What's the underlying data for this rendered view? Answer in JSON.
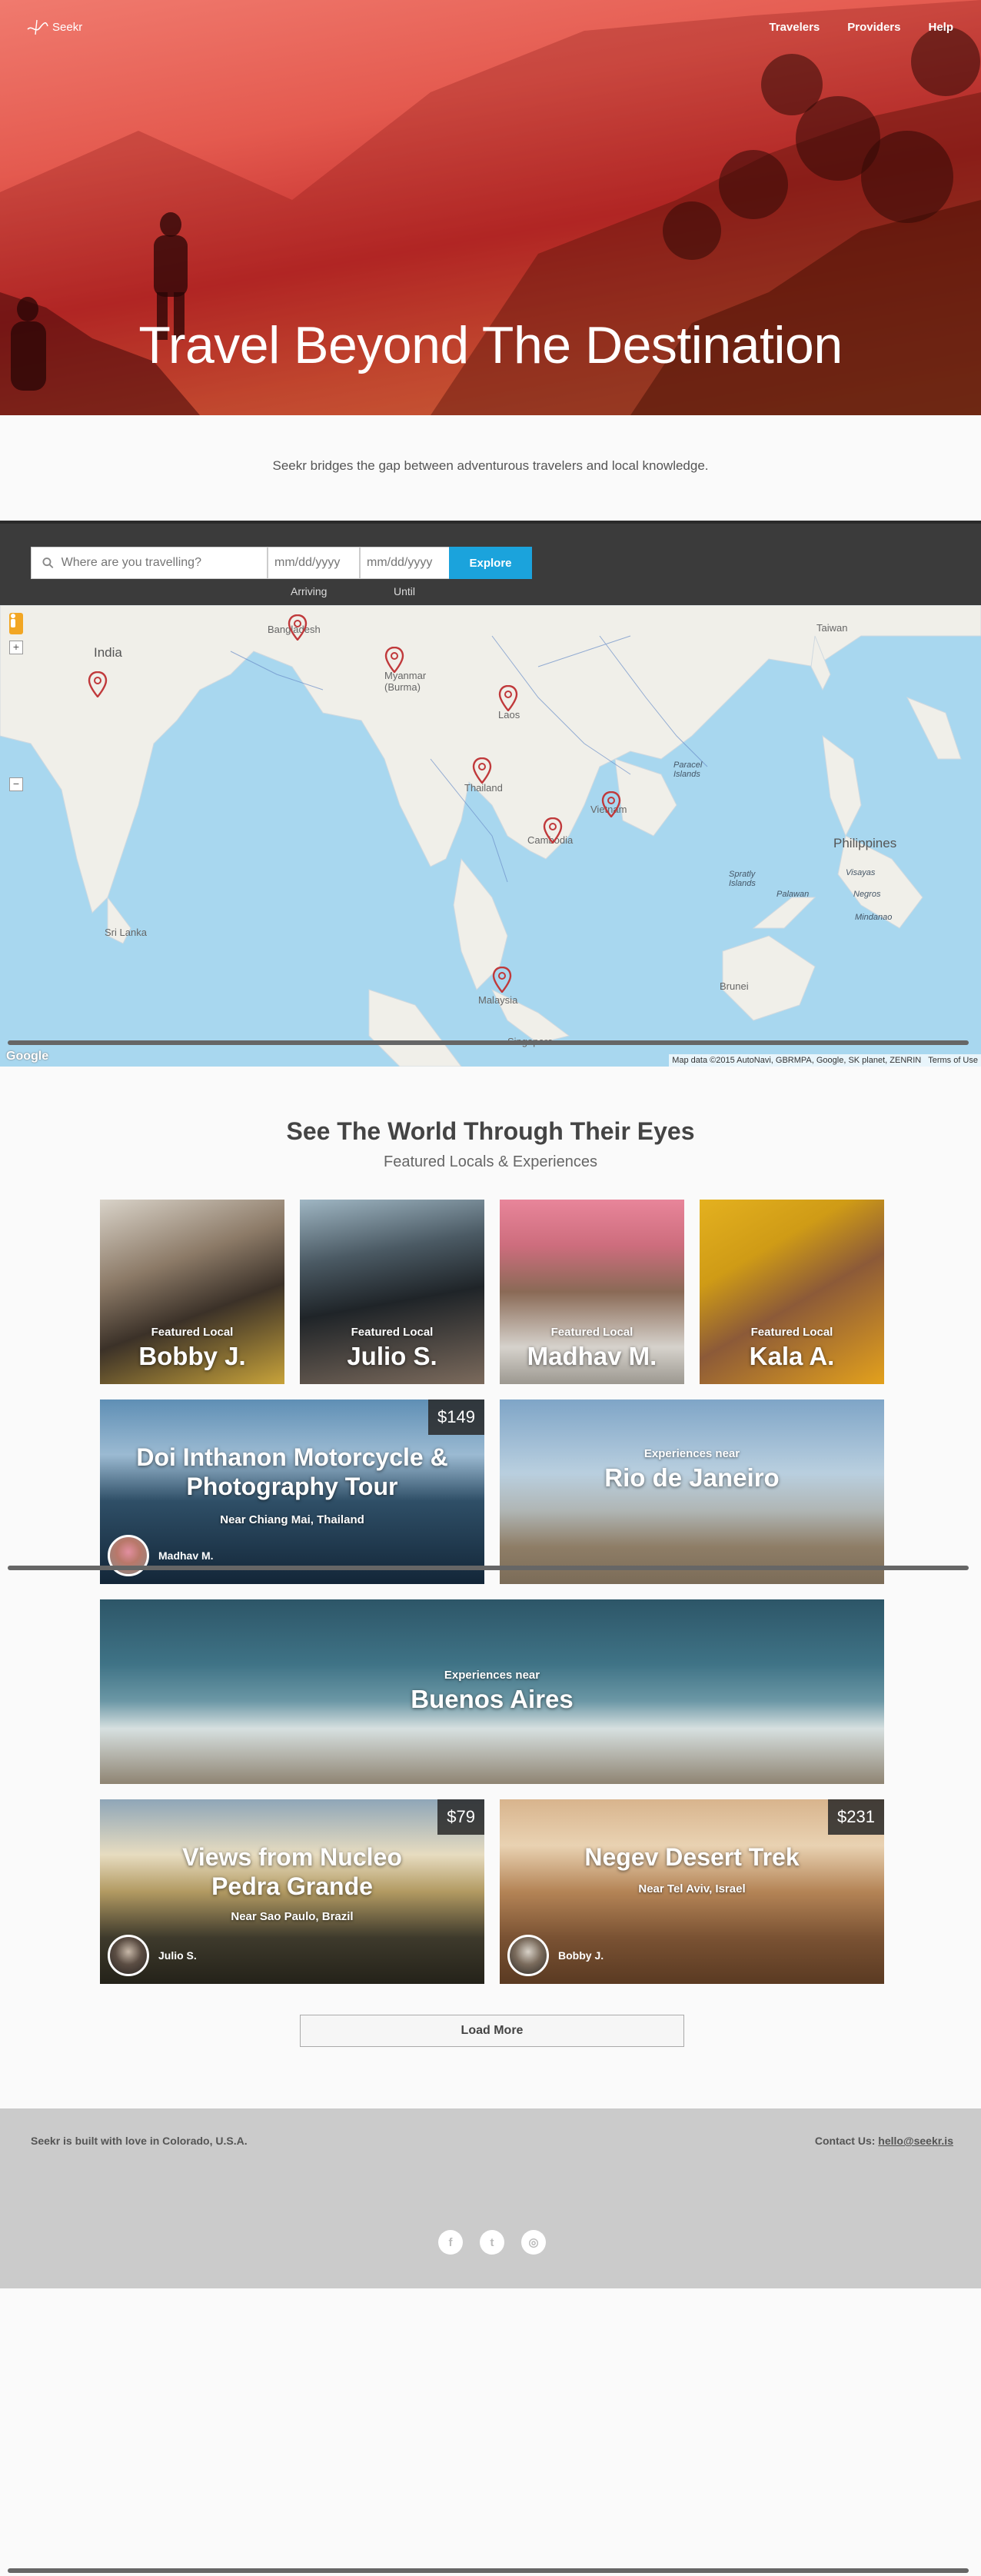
{
  "header": {
    "logo_text": "Seekr",
    "nav": [
      "Travelers",
      "Providers",
      "Help"
    ]
  },
  "hero": {
    "title": "Travel Beyond The Destination"
  },
  "tagline": "Seekr bridges the gap between adventurous travelers and local knowledge.",
  "search": {
    "place_placeholder": "Where are you travelling?",
    "date_placeholder": "mm/dd/yyyy",
    "button": "Explore",
    "arriving_label": "Arriving",
    "until_label": "Until"
  },
  "map": {
    "labels": [
      "India",
      "Bangladesh",
      "Myanmar (Burma)",
      "Laos",
      "Thailand",
      "Vietnam",
      "Cambodia",
      "Taiwan",
      "Philippines",
      "Sri Lanka",
      "Malaysia",
      "Singapore",
      "Brunei",
      "Paracel Islands",
      "Spratly Islands",
      "Palawan",
      "Visayas",
      "Negros",
      "Mindanao"
    ],
    "attribution": "Map data ©2015 AutoNavi, GBRMPA, Google, SK planet, ZENRIN",
    "terms": "Terms of Use",
    "google": "Google",
    "zoom_in": "+",
    "zoom_out": "−"
  },
  "featured": {
    "title": "See The World Through Their Eyes",
    "subtitle": "Featured Locals & Experiences",
    "locals": [
      {
        "tag": "Featured Local",
        "name": "Bobby J."
      },
      {
        "tag": "Featured Local",
        "name": "Julio S."
      },
      {
        "tag": "Featured Local",
        "name": "Madhav M."
      },
      {
        "tag": "Featured Local",
        "name": "Kala A."
      }
    ],
    "experiences": [
      {
        "title": "Doi Inthanon Motorcycle & Photography Tour",
        "location": "Near Chiang Mai, Thailand",
        "price": "$149",
        "host": "Madhav M."
      },
      {
        "tag": "Experiences near",
        "name": "Rio de Janeiro"
      },
      {
        "tag": "Experiences near",
        "name": "Buenos Aires"
      },
      {
        "title": "Views from Nucleo Pedra Grande",
        "location": "Near Sao Paulo, Brazil",
        "price": "$79",
        "host": "Julio S."
      },
      {
        "title": "Negev Desert Trek",
        "location": "Near Tel Aviv, Israel",
        "price": "$231",
        "host": "Bobby J."
      }
    ],
    "load_more": "Load More"
  },
  "footer": {
    "left": "Seekr is built with love in Colorado, U.S.A.",
    "contact_label": "Contact Us:",
    "contact_email": "hello@seekr.is",
    "social": [
      "f",
      "t",
      "◎"
    ]
  },
  "colors": {
    "accent": "#1ba3dc",
    "search_bar": "#3b3b3b",
    "footer": "#cbcbcb",
    "water": "#a8d7ef",
    "land": "#f0efe9",
    "pin": "#c0393b"
  }
}
